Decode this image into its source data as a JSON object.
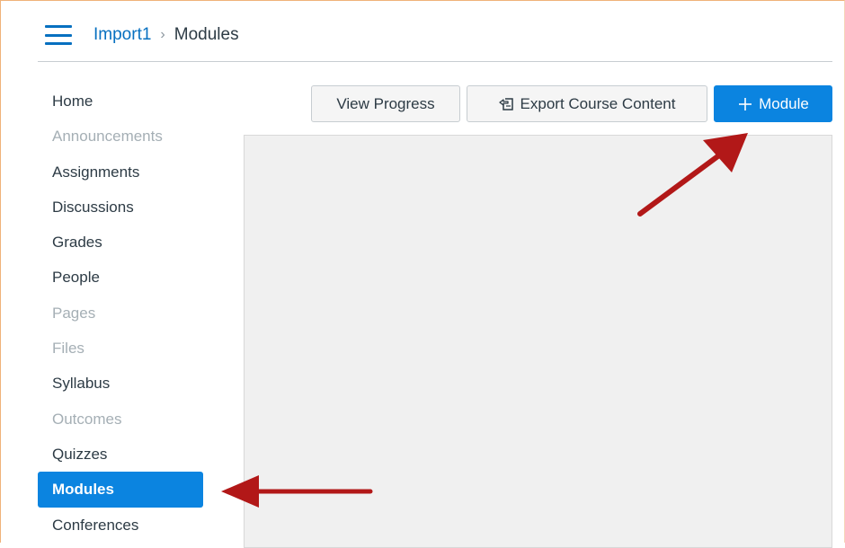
{
  "header": {
    "breadcrumb_course": "Import1",
    "breadcrumb_separator": "›",
    "breadcrumb_current": "Modules"
  },
  "sidebar": {
    "items": [
      {
        "label": "Home",
        "state": "enabled"
      },
      {
        "label": "Announcements",
        "state": "disabled"
      },
      {
        "label": "Assignments",
        "state": "enabled"
      },
      {
        "label": "Discussions",
        "state": "enabled"
      },
      {
        "label": "Grades",
        "state": "enabled"
      },
      {
        "label": "People",
        "state": "enabled"
      },
      {
        "label": "Pages",
        "state": "disabled"
      },
      {
        "label": "Files",
        "state": "disabled"
      },
      {
        "label": "Syllabus",
        "state": "enabled"
      },
      {
        "label": "Outcomes",
        "state": "disabled"
      },
      {
        "label": "Quizzes",
        "state": "enabled"
      },
      {
        "label": "Modules",
        "state": "active"
      },
      {
        "label": "Conferences",
        "state": "enabled"
      }
    ]
  },
  "toolbar": {
    "view_progress_label": "View Progress",
    "export_label": "Export Course Content",
    "add_module_label": "Module"
  },
  "icons": {
    "menu": "hamburger-icon",
    "export": "export-icon",
    "add": "plus-icon",
    "annotation": "red-arrow-icon"
  },
  "colors": {
    "brand_blue": "#0b84e0",
    "link_blue": "#0770c0",
    "annotation_red": "#b21818",
    "text_dark": "#2d3b45",
    "text_disabled": "#a5afb5"
  }
}
